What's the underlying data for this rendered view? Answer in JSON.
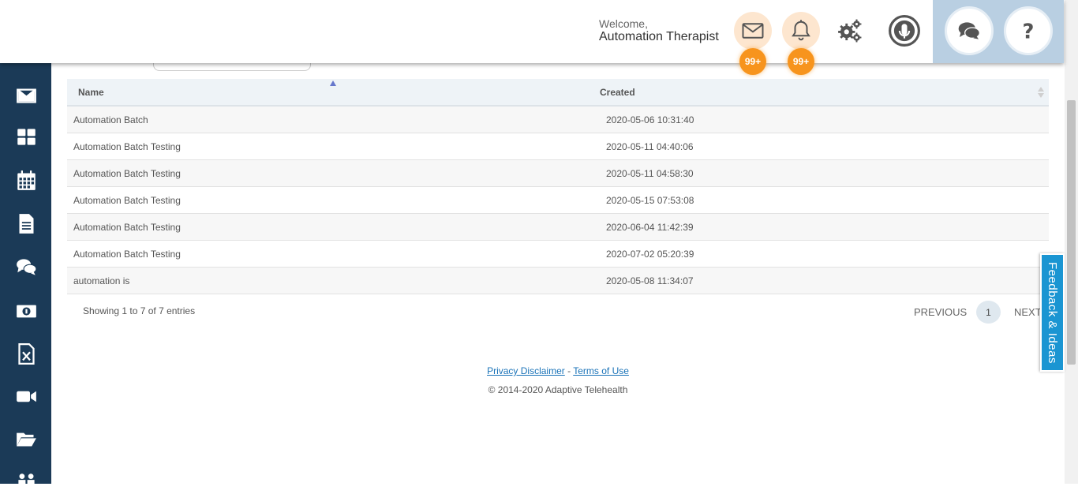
{
  "header": {
    "welcome_label": "Welcome,",
    "user_name": "Automation Therapist",
    "mail_badge": "99+",
    "notification_badge": "99+"
  },
  "colors": {
    "sidebar": "#1b3a57",
    "badge": "#f7941d",
    "feedback": "#1a95d2",
    "header_panel": "#b9cfe2"
  },
  "sidebar": {
    "icons": [
      "envelope-icon",
      "dashboard-icon",
      "calendar-icon",
      "document-icon",
      "chat-icon",
      "money-icon",
      "excel-icon",
      "video-icon",
      "folder-open-icon",
      "users-icon"
    ]
  },
  "table": {
    "columns": [
      "Name",
      "Created"
    ],
    "rows": [
      {
        "name": "Automation Batch",
        "created": "2020-05-06 10:31:40"
      },
      {
        "name": "Automation Batch Testing",
        "created": "2020-05-11 04:40:06"
      },
      {
        "name": "Automation Batch Testing",
        "created": "2020-05-11 04:58:30"
      },
      {
        "name": "Automation Batch Testing",
        "created": "2020-05-15 07:53:08"
      },
      {
        "name": "Automation Batch Testing",
        "created": "2020-06-04 11:42:39"
      },
      {
        "name": "Automation Batch Testing",
        "created": "2020-07-02 05:20:39"
      },
      {
        "name": "automation is",
        "created": "2020-05-08 11:34:07"
      }
    ],
    "info": "Showing 1 to 7 of 7 entries"
  },
  "pagination": {
    "previous": "PREVIOUS",
    "current": "1",
    "next": "NEXT"
  },
  "feedback": "Feedback & Ideas",
  "footer": {
    "privacy": "Privacy Disclaimer",
    "separator": "-",
    "terms": "Terms of Use",
    "copyright": "© 2014-2020 Adaptive Telehealth"
  }
}
